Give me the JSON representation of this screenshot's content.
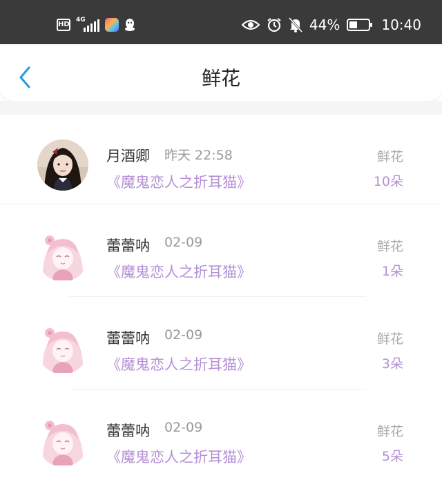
{
  "status_bar": {
    "hd": "HD",
    "network": "4G",
    "battery": "44%",
    "battery_level": 0.44,
    "time": "10:40",
    "icons": [
      "hd-icon",
      "signal-icon",
      "app-icon",
      "qq-icon",
      "eye-icon",
      "alarm-icon",
      "bell-off-icon",
      "battery-icon"
    ]
  },
  "header": {
    "title": "鲜花",
    "back_icon": "chevron-left-icon"
  },
  "colors": {
    "accent": "#2f9be0",
    "purple": "#b48fd6",
    "gray_text": "#999999",
    "title_text": "#222222"
  },
  "records": [
    {
      "name": "月酒卿",
      "time": "昨天 22:58",
      "book": "《魔鬼恋人之折耳猫》",
      "kind": "鲜花",
      "count": "10朵",
      "avatar": "photo-avatar"
    },
    {
      "name": "蕾蕾呐",
      "time": "02-09",
      "book": "《魔鬼恋人之折耳猫》",
      "kind": "鲜花",
      "count": "1朵",
      "avatar": "anime-avatar"
    },
    {
      "name": "蕾蕾呐",
      "time": "02-09",
      "book": "《魔鬼恋人之折耳猫》",
      "kind": "鲜花",
      "count": "3朵",
      "avatar": "anime-avatar"
    },
    {
      "name": "蕾蕾呐",
      "time": "02-09",
      "book": "《魔鬼恋人之折耳猫》",
      "kind": "鲜花",
      "count": "5朵",
      "avatar": "anime-avatar"
    }
  ]
}
